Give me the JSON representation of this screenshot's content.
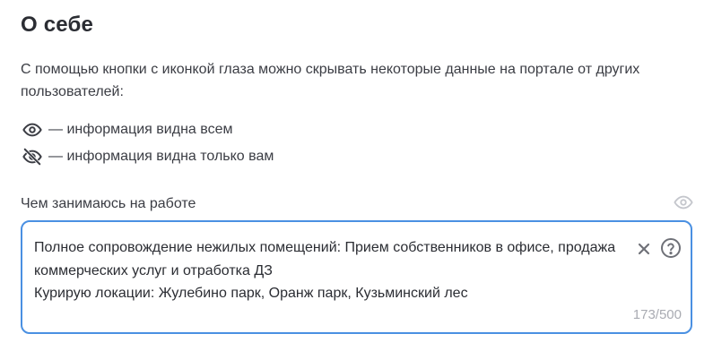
{
  "section": {
    "title": "О себе",
    "description": "С помощью кнопки с иконкой глаза можно скрывать некоторые данные на портале от других пользователей:"
  },
  "legend": {
    "visible_all": {
      "icon": "eye-icon",
      "text": "— информация видна всем"
    },
    "visible_you": {
      "icon": "eye-off-icon",
      "text": "— информация видна только вам"
    }
  },
  "field": {
    "label": "Чем занимаюсь на работе",
    "value": "Полное сопровождение нежилых помещений: Прием собственников в офисе, продажа коммерческих услуг и отработка ДЗ\nКурирую локации: Жулебино парк, Оранж парк, Кузьминский лес",
    "counter": "173/500",
    "visibility_icon": "eye-icon"
  },
  "colors": {
    "accent": "#4a90e2",
    "text": "#2b2d33",
    "muted": "#a9abb2",
    "icon_light": "#c4c6cc"
  }
}
